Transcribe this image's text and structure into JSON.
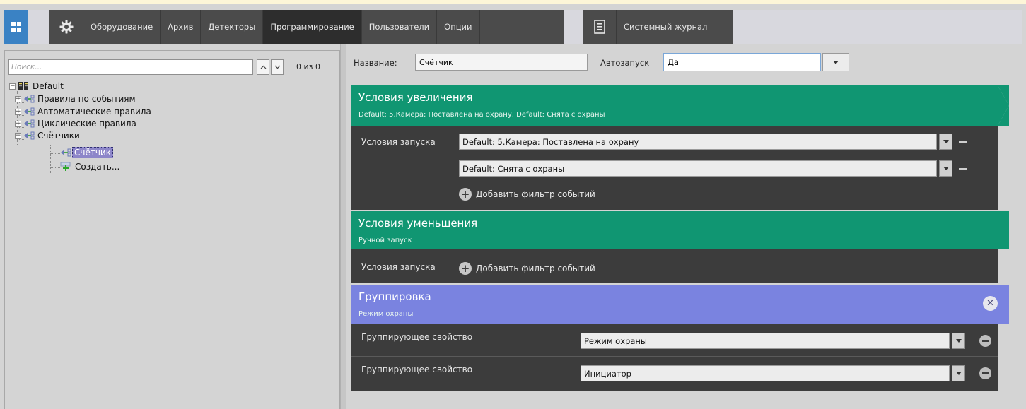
{
  "nav": {
    "tabs": [
      {
        "label": "Оборудование",
        "active": false
      },
      {
        "label": "Архив",
        "active": false
      },
      {
        "label": "Детекторы",
        "active": false
      },
      {
        "label": "Программирование",
        "active": true
      },
      {
        "label": "Пользователи",
        "active": false
      },
      {
        "label": "Опции",
        "active": false
      }
    ],
    "journal_label": "Системный журнал",
    "icons": [
      "windows-grid-icon",
      "gear-icon",
      "journal-icon"
    ]
  },
  "search": {
    "placeholder": "Поиск...",
    "value": "",
    "count": "0 из 0"
  },
  "tree": {
    "root": "Default",
    "items": [
      {
        "label": "Правила по событиям"
      },
      {
        "label": "Автоматические правила"
      },
      {
        "label": "Циклические правила"
      },
      {
        "label": "Счётчики"
      }
    ],
    "children": [
      {
        "label": "Счётчик",
        "selected": true
      },
      {
        "label": "Создать..."
      }
    ]
  },
  "form": {
    "name_label": "Название:",
    "name_value": "Счётчик",
    "autostart_label": "Автозапуск",
    "autostart_value": "Да"
  },
  "increase": {
    "title": "Условия увеличения",
    "subtitle": "Default: 5.Камера: Поставлена на охрану, Default: Снята с охраны",
    "start_label": "Условия запуска",
    "conditions": [
      "Default: 5.Камера: Поставлена на охрану",
      "Default: Снята с охраны"
    ],
    "add_filter": "Добавить фильтр событий"
  },
  "decrease": {
    "title": "Условия уменьшения",
    "subtitle": "Ручной запуск",
    "start_label": "Условия запуска",
    "add_filter": "Добавить фильтр событий"
  },
  "grouping": {
    "title": "Группировка",
    "subtitle": "Режим охраны",
    "rows": [
      {
        "label": "Группирующее свойство",
        "value": "Режим охраны"
      },
      {
        "label": "Группирующее свойство",
        "value": "Инициатор"
      }
    ]
  },
  "colors": {
    "green_header": "#109672",
    "purple_header": "#7a83e0",
    "dark_body": "#3c3c3c",
    "nav_active": "#2d2d2d",
    "app_button": "#3a82c4"
  }
}
